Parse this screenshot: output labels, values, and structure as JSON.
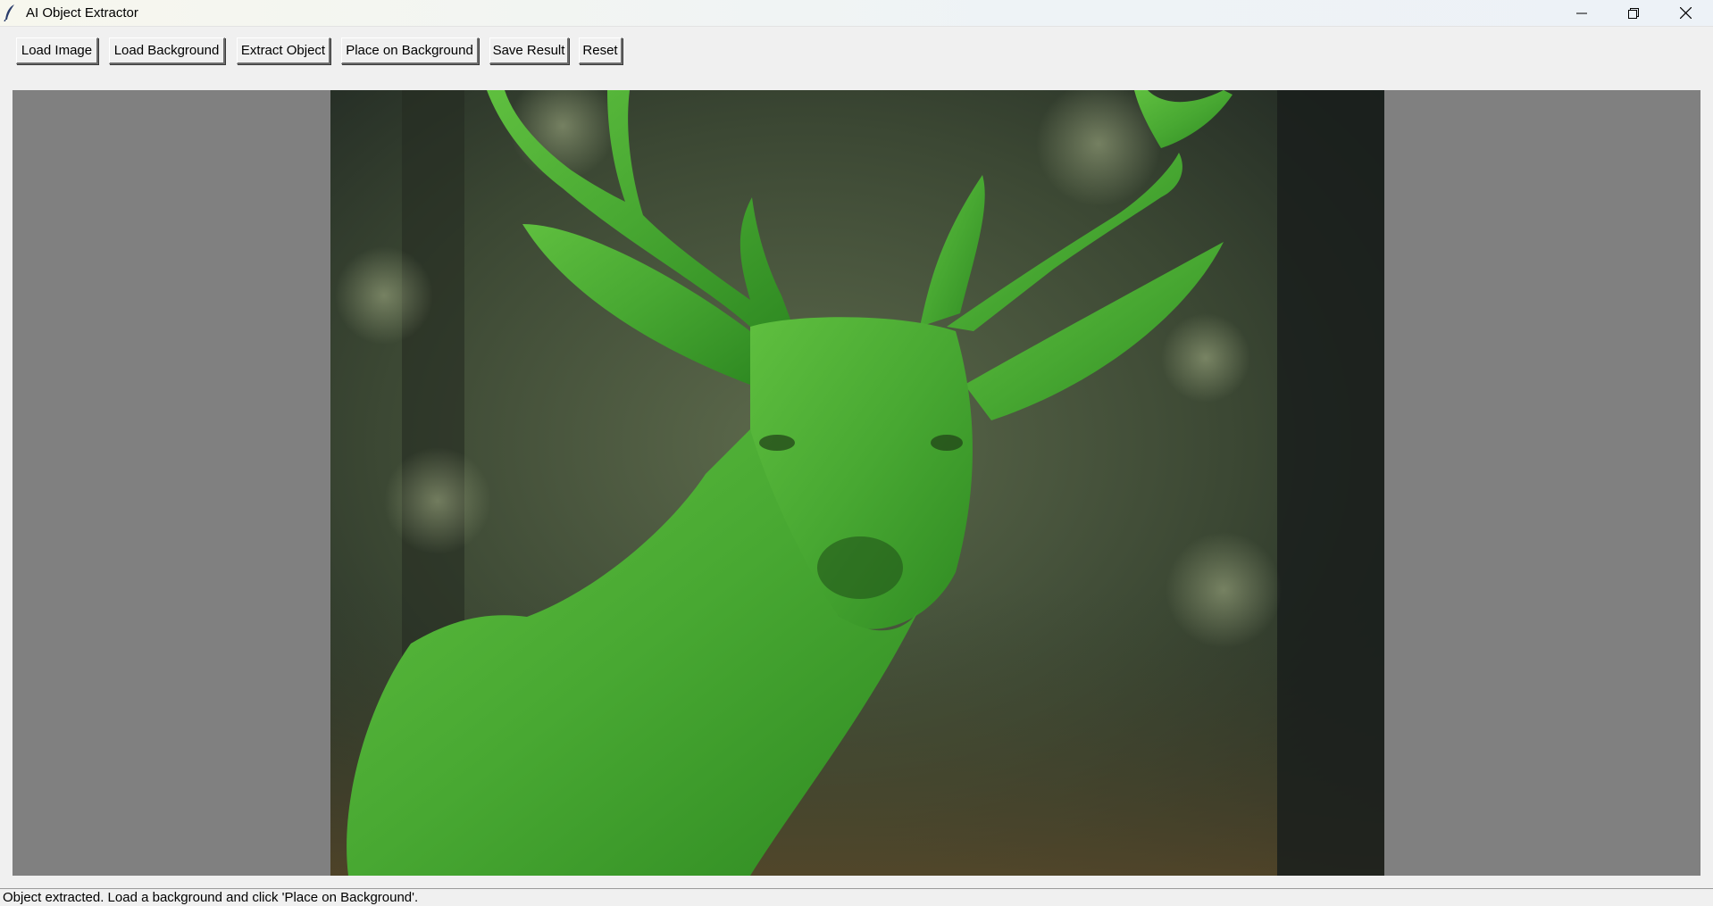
{
  "window": {
    "title": "AI Object Extractor",
    "icon": "feather-icon"
  },
  "toolbar": {
    "buttons": [
      {
        "label": "Load Image"
      },
      {
        "label": "Load Background"
      },
      {
        "label": "Extract Object"
      },
      {
        "label": "Place on Background"
      },
      {
        "label": "Save Result"
      },
      {
        "label": "Reset"
      }
    ]
  },
  "canvas": {
    "background_color": "#808080",
    "image_subject": "deer with extracted-object green mask overlay",
    "mask_color": "#3fae2a"
  },
  "status": {
    "text": "Object extracted. Load a background and click 'Place on Background'."
  }
}
